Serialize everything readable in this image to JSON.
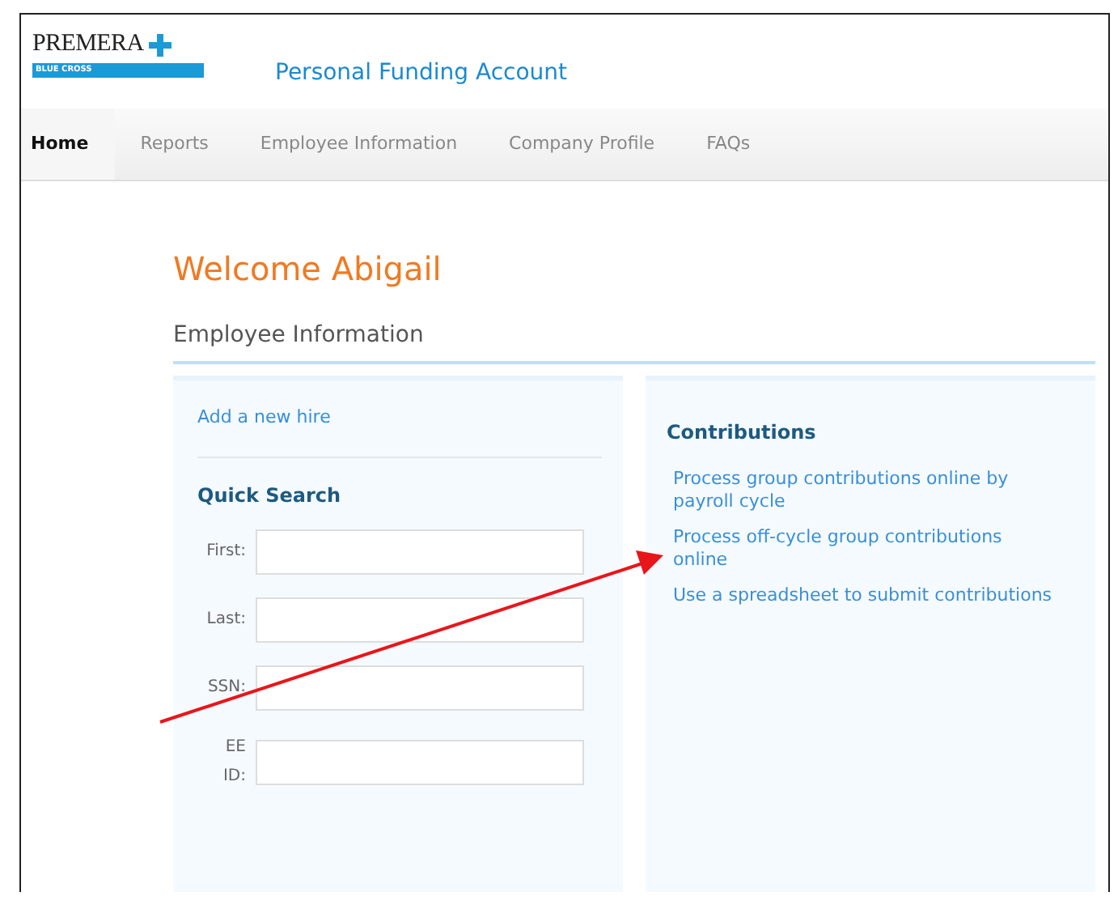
{
  "logo": {
    "wordmark": "PREMERA",
    "tagline": "BLUE CROSS"
  },
  "app_title": "Personal Funding Account",
  "nav": [
    {
      "label": "Home",
      "selected": true
    },
    {
      "label": "Reports",
      "selected": false
    },
    {
      "label": "Employee Information",
      "selected": false
    },
    {
      "label": "Company Profile",
      "selected": false
    },
    {
      "label": "FAQs",
      "selected": false
    }
  ],
  "welcome": "Welcome Abigail",
  "section_title": "Employee Information",
  "left_panel": {
    "link": "Add a new hire",
    "search_title": "Quick Search",
    "fields": [
      {
        "label": "First:"
      },
      {
        "label": "Last:"
      },
      {
        "label": "SSN:"
      },
      {
        "label": "EE ID:"
      }
    ]
  },
  "right_panel": {
    "title": "Contributions",
    "links": [
      "Process group contributions online by payroll cycle",
      "Process off-cycle group contributions online",
      "Use a spreadsheet to submit contributions"
    ]
  }
}
